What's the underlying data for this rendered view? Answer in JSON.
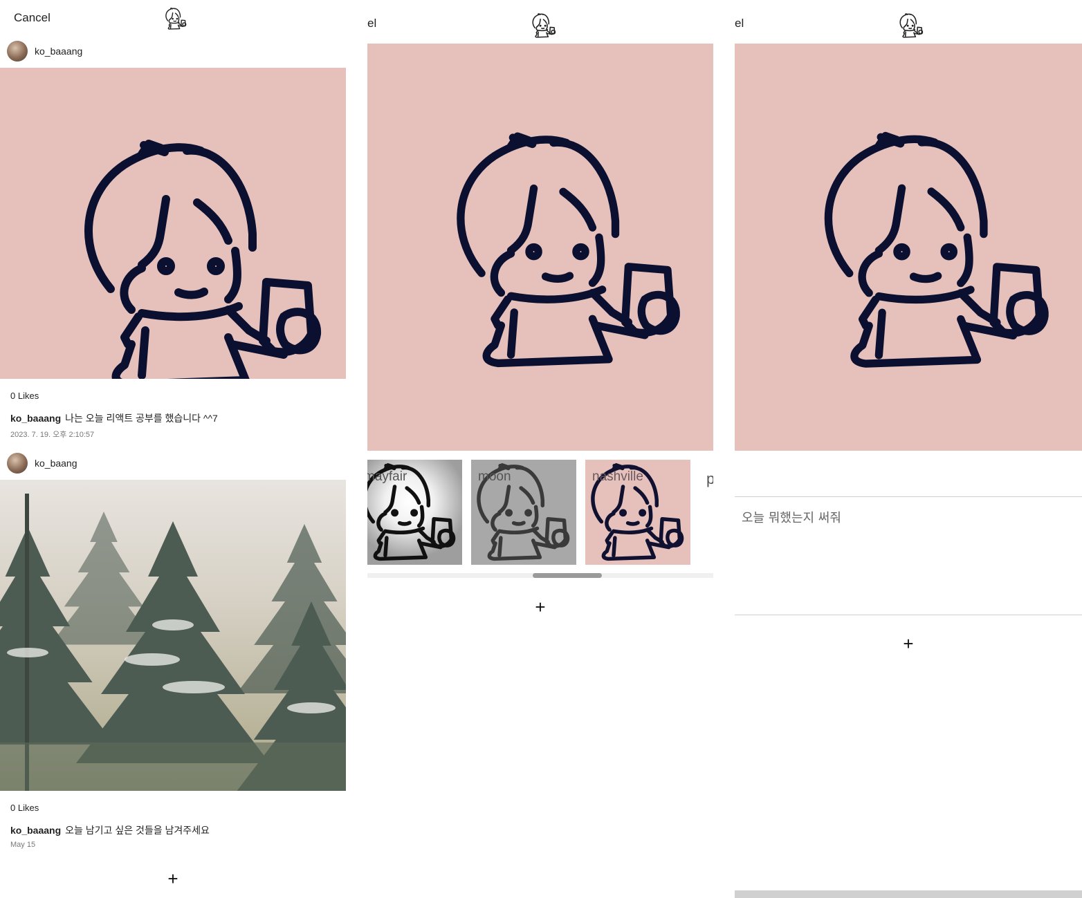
{
  "feed": {
    "cancel_label": "Cancel",
    "logo_icon": "character-logo-icon",
    "posts": [
      {
        "username": "ko_baaang",
        "likes": "0 Likes",
        "caption_user": "ko_baaang",
        "caption_text": "나는 오늘 리액트 공부를 했습니다 ^^7",
        "timestamp": "2023. 7. 19. 오후 2:10:57",
        "image": "character-drawing"
      },
      {
        "username": "ko_baang",
        "likes": "0 Likes",
        "caption_user": "ko_baaang",
        "caption_text": "오늘 남기고 싶은 것들을 남겨주세요",
        "timestamp": "May 15",
        "image": "snowy-pine-forest"
      }
    ],
    "add_label": "+"
  },
  "filter_screen": {
    "cancel_label_partial": "el",
    "filters": [
      {
        "name": "mayfair"
      },
      {
        "name": "moon"
      },
      {
        "name": "nashville"
      },
      {
        "name": "p"
      }
    ],
    "add_label": "+"
  },
  "write_screen": {
    "cancel_label_partial": "el",
    "textarea_placeholder": "오늘 뭐했는지 써줘",
    "add_label": "+"
  },
  "colors": {
    "pink_bg": "#e6c1bc",
    "ink": "#0b1030"
  }
}
